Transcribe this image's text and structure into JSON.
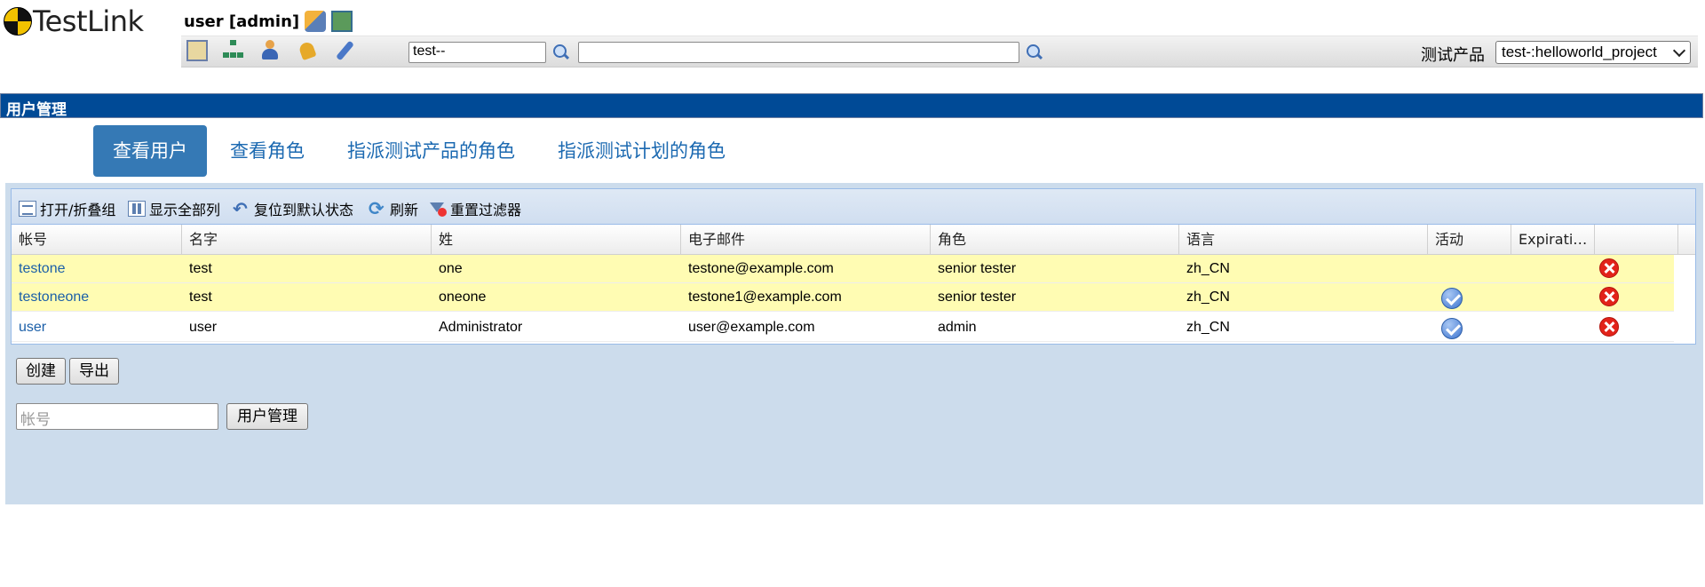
{
  "app": {
    "logo_text": "TestLink"
  },
  "header": {
    "user_label": "user [admin]",
    "search_value": "test--",
    "search_value_2": "",
    "product_label": "测试产品",
    "product_selected": "test-:helloworld_project"
  },
  "page": {
    "title": "用户管理"
  },
  "tabs": [
    {
      "label": "查看用户",
      "active": true
    },
    {
      "label": "查看角色",
      "active": false
    },
    {
      "label": "指派测试产品的角色",
      "active": false
    },
    {
      "label": "指派测试计划的角色",
      "active": false
    }
  ],
  "toolbar": {
    "collapse_label": "打开/折叠组",
    "show_columns_label": "显示全部列",
    "reset_label": "复位到默认状态",
    "refresh_label": "刷新",
    "reset_filters_label": "重置过滤器"
  },
  "table": {
    "columns": [
      "帐号",
      "名字",
      "姓",
      "电子邮件",
      "角色",
      "语言",
      "活动",
      "Expirati…",
      ""
    ],
    "rows": [
      {
        "account": "testone",
        "first_name": "test",
        "last_name": "one",
        "email": "testone@example.com",
        "role": "senior tester",
        "locale": "zh_CN",
        "active": false
      },
      {
        "account": "testoneone",
        "first_name": "test",
        "last_name": "oneone",
        "email": "testone1@example.com",
        "role": "senior tester",
        "locale": "zh_CN",
        "active": true
      },
      {
        "account": "user",
        "first_name": "user",
        "last_name": "Administrator",
        "email": "user@example.com",
        "role": "admin",
        "locale": "zh_CN",
        "active": true
      }
    ]
  },
  "actions": {
    "create_label": "创建",
    "export_label": "导出",
    "account_placeholder": "帐号",
    "user_mgmt_label": "用户管理"
  },
  "colors": {
    "title_bar": "#004a96",
    "active_tab": "#3579b5",
    "link": "#1b5fa8",
    "panel_bg": "#ccdcec",
    "highlight_row": "#fffcb3"
  }
}
